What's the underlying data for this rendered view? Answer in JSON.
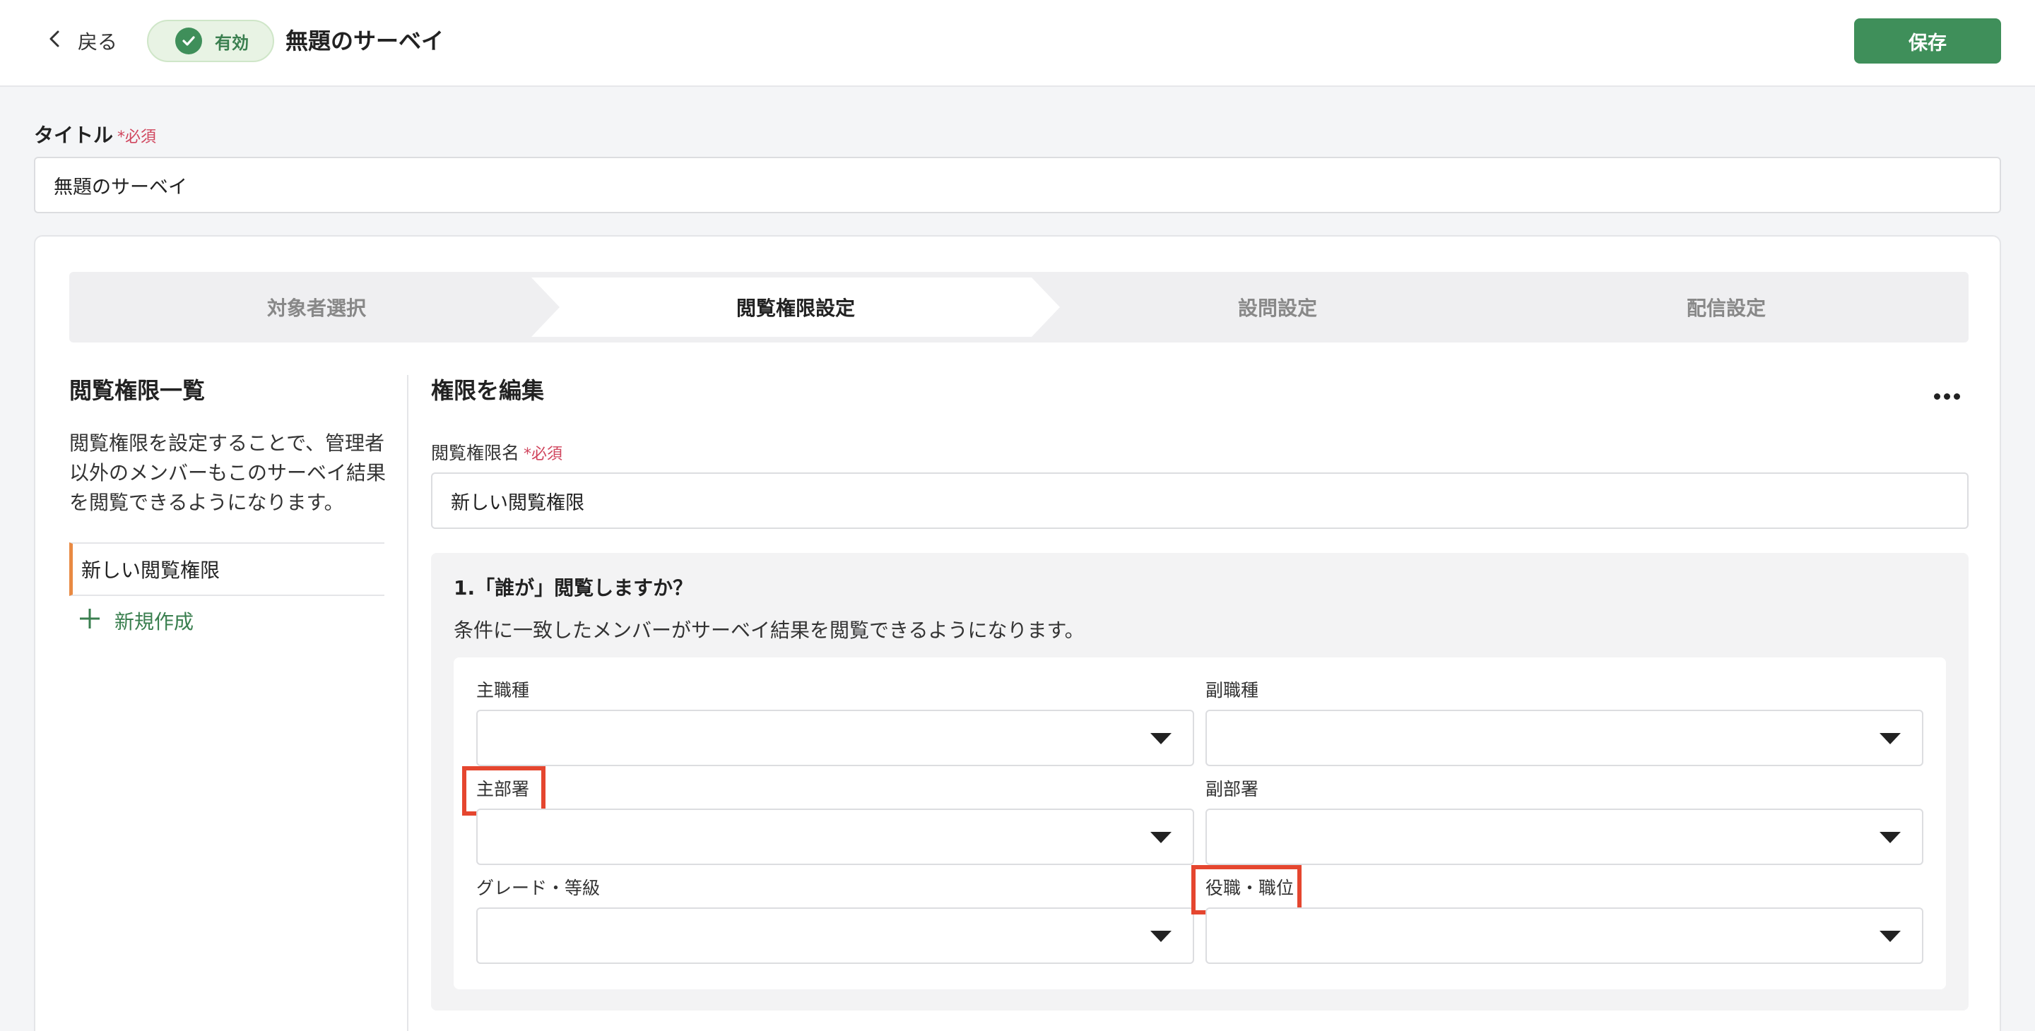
{
  "header": {
    "back_label": "戻る",
    "status_label": "有効",
    "page_title": "無題のサーベイ",
    "save_label": "保存"
  },
  "title_field": {
    "label": "タイトル",
    "required": "*必須",
    "value": "無題のサーベイ"
  },
  "stepper": {
    "steps": [
      {
        "label": "対象者選択",
        "active": false
      },
      {
        "label": "閲覧権限設定",
        "active": true
      },
      {
        "label": "設問設定",
        "active": false
      },
      {
        "label": "配信設定",
        "active": false
      }
    ]
  },
  "left_panel": {
    "title": "閲覧権限一覧",
    "description": "閲覧権限を設定することで、管理者以外のメンバーもこのサーベイ結果を閲覧できるようになります。",
    "items": [
      {
        "label": "新しい閲覧権限",
        "selected": true
      }
    ],
    "new_label": "新規作成"
  },
  "right_panel": {
    "title": "権限を編集",
    "name_label": "閲覧権限名",
    "name_required": "*必須",
    "name_value": "新しい閲覧権限",
    "who": {
      "question": "1.「誰が」閲覧しますか？",
      "description": "条件に一致したメンバーがサーベイ結果を閲覧できるようになります。",
      "fields": [
        {
          "label": "主職種",
          "value": ""
        },
        {
          "label": "副職種",
          "value": ""
        },
        {
          "label": "主部署",
          "value": "",
          "highlighted": true
        },
        {
          "label": "副部署",
          "value": ""
        },
        {
          "label": "グレード・等級",
          "value": ""
        },
        {
          "label": "役職・職位",
          "value": "",
          "highlighted": true
        }
      ]
    }
  },
  "colors": {
    "accent_green": "#3f8f5a",
    "required_red": "#d0455d",
    "selected_marker": "#e98a43",
    "highlight_box": "#e5462f"
  },
  "icons": [
    "chevron-left-icon",
    "check-icon",
    "plus-icon",
    "more-horizontal-icon",
    "caret-down-icon"
  ]
}
